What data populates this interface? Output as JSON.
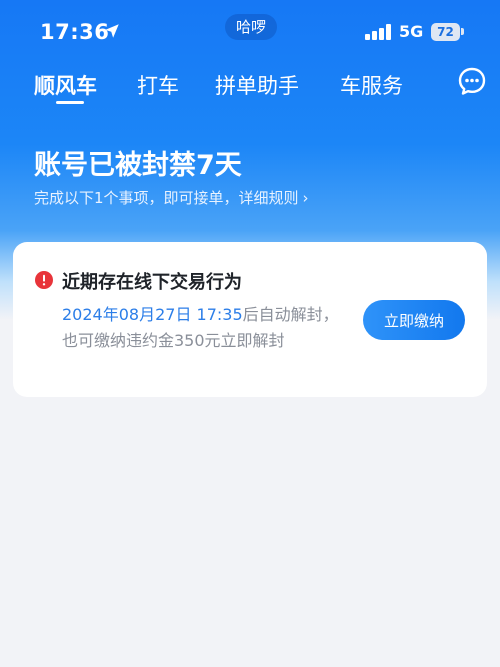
{
  "status_bar": {
    "time": "17:36",
    "app_pill": "哈啰",
    "network": "5G",
    "battery": "72",
    "icons": [
      "location-arrow-icon",
      "signal-icon",
      "battery-icon"
    ]
  },
  "tabs": [
    {
      "label": "顺风车",
      "active": true
    },
    {
      "label": "打车",
      "active": false
    },
    {
      "label": "拼单助手",
      "active": false
    },
    {
      "label": "车服务",
      "active": false
    }
  ],
  "header_icons": [
    "chat-bubble-icon"
  ],
  "ban": {
    "title": "账号已被封禁7天",
    "subtitle": "完成以下1个事项，即可接单，详细规则",
    "subtitle_chevron": "›"
  },
  "notice_card": {
    "title": "近期存在线下交易行为",
    "datetime": "2024年08月27日 17:35",
    "desc_rest": "后自动解封，也可缴纳违约金350元立即解封",
    "button_label": "立即缴纳"
  },
  "colors": {
    "brand_blue": "#1678f5",
    "warning_red": "#e8343a",
    "highlight_blue": "#2c7ee8",
    "page_bg": "#f2f3f7"
  }
}
